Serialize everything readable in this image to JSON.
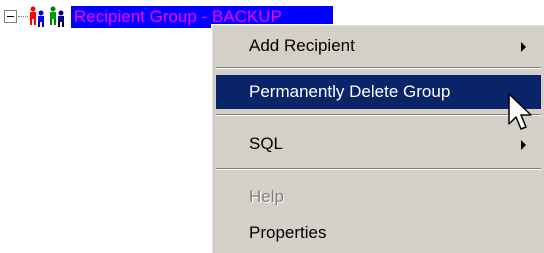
{
  "tree": {
    "node_label": "Recipient Group - BACKUP",
    "expander_icon": "minus-box-icon",
    "group_icon": "recipient-group-icon"
  },
  "context_menu": {
    "items": [
      {
        "label": "Add Recipient",
        "has_submenu": true,
        "state": "normal"
      },
      {
        "label": "Permanently Delete Group",
        "has_submenu": false,
        "state": "highlighted"
      },
      {
        "label": "SQL",
        "has_submenu": true,
        "state": "normal"
      },
      {
        "label": "Help",
        "has_submenu": false,
        "state": "disabled"
      },
      {
        "label": "Properties",
        "has_submenu": false,
        "state": "normal"
      }
    ],
    "highlight_color": "#0a246a",
    "background_color": "#d4d0c8",
    "disabled_color": "#808080"
  },
  "cursor": {
    "icon": "arrow-cursor-icon"
  }
}
